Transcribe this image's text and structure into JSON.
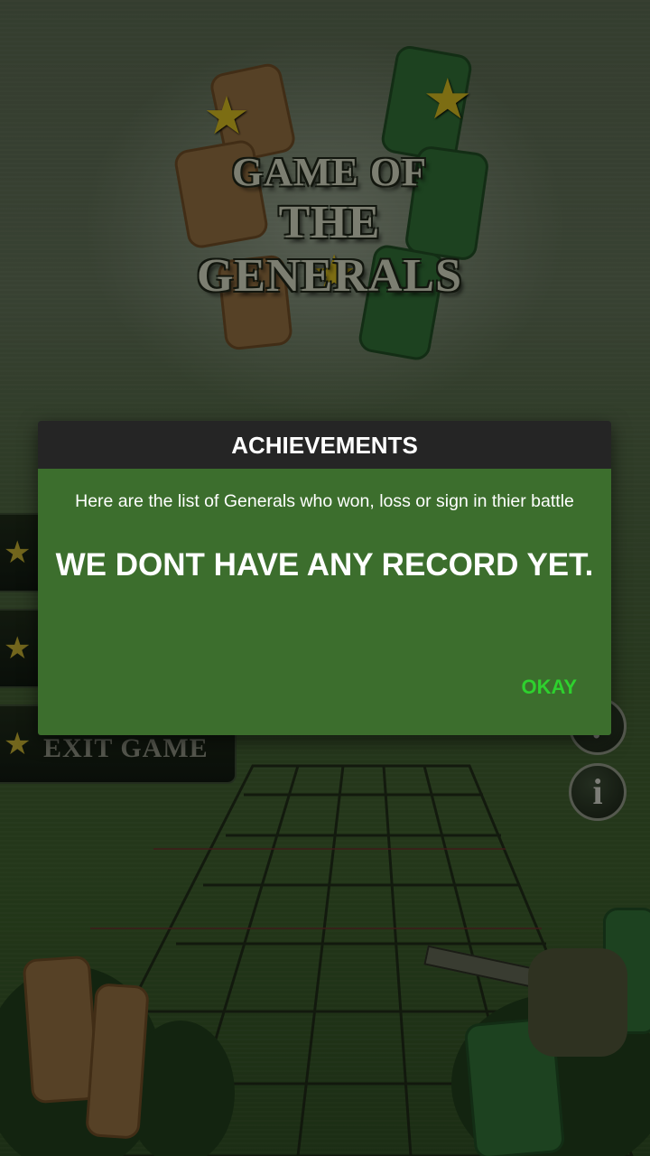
{
  "background": {
    "logo": {
      "line1": "GAME OF",
      "line2": "THE GENERALS"
    },
    "menu": {
      "exit_label": "EXIT GAME"
    },
    "right_buttons": {
      "help_symbol": "?",
      "info_symbol": "i"
    }
  },
  "dialog": {
    "title": "ACHIEVEMENTS",
    "description": "Here are the list of Generals who won, loss or sign in thier battle",
    "message": "WE DONT HAVE ANY RECORD YET.",
    "ok_label": "OKAY"
  },
  "colors": {
    "dialog_body": "#3c6e2d",
    "dialog_header": "#252525",
    "ok_button": "#2ed12e"
  },
  "icons": [
    "star-icon",
    "help-icon",
    "info-icon"
  ]
}
